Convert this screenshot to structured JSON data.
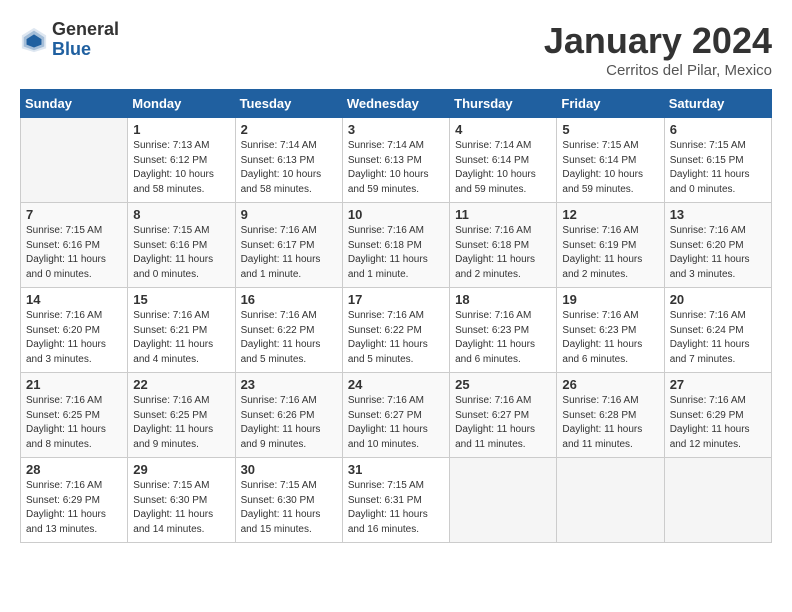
{
  "header": {
    "logo": {
      "general": "General",
      "blue": "Blue"
    },
    "title": "January 2024",
    "subtitle": "Cerritos del Pilar, Mexico"
  },
  "weekdays": [
    "Sunday",
    "Monday",
    "Tuesday",
    "Wednesday",
    "Thursday",
    "Friday",
    "Saturday"
  ],
  "weeks": [
    [
      {
        "day": "",
        "info": ""
      },
      {
        "day": "1",
        "info": "Sunrise: 7:13 AM\nSunset: 6:12 PM\nDaylight: 10 hours\nand 58 minutes."
      },
      {
        "day": "2",
        "info": "Sunrise: 7:14 AM\nSunset: 6:13 PM\nDaylight: 10 hours\nand 58 minutes."
      },
      {
        "day": "3",
        "info": "Sunrise: 7:14 AM\nSunset: 6:13 PM\nDaylight: 10 hours\nand 59 minutes."
      },
      {
        "day": "4",
        "info": "Sunrise: 7:14 AM\nSunset: 6:14 PM\nDaylight: 10 hours\nand 59 minutes."
      },
      {
        "day": "5",
        "info": "Sunrise: 7:15 AM\nSunset: 6:14 PM\nDaylight: 10 hours\nand 59 minutes."
      },
      {
        "day": "6",
        "info": "Sunrise: 7:15 AM\nSunset: 6:15 PM\nDaylight: 11 hours\nand 0 minutes."
      }
    ],
    [
      {
        "day": "7",
        "info": "Sunrise: 7:15 AM\nSunset: 6:16 PM\nDaylight: 11 hours\nand 0 minutes."
      },
      {
        "day": "8",
        "info": "Sunrise: 7:15 AM\nSunset: 6:16 PM\nDaylight: 11 hours\nand 0 minutes."
      },
      {
        "day": "9",
        "info": "Sunrise: 7:16 AM\nSunset: 6:17 PM\nDaylight: 11 hours\nand 1 minute."
      },
      {
        "day": "10",
        "info": "Sunrise: 7:16 AM\nSunset: 6:18 PM\nDaylight: 11 hours\nand 1 minute."
      },
      {
        "day": "11",
        "info": "Sunrise: 7:16 AM\nSunset: 6:18 PM\nDaylight: 11 hours\nand 2 minutes."
      },
      {
        "day": "12",
        "info": "Sunrise: 7:16 AM\nSunset: 6:19 PM\nDaylight: 11 hours\nand 2 minutes."
      },
      {
        "day": "13",
        "info": "Sunrise: 7:16 AM\nSunset: 6:20 PM\nDaylight: 11 hours\nand 3 minutes."
      }
    ],
    [
      {
        "day": "14",
        "info": "Sunrise: 7:16 AM\nSunset: 6:20 PM\nDaylight: 11 hours\nand 3 minutes."
      },
      {
        "day": "15",
        "info": "Sunrise: 7:16 AM\nSunset: 6:21 PM\nDaylight: 11 hours\nand 4 minutes."
      },
      {
        "day": "16",
        "info": "Sunrise: 7:16 AM\nSunset: 6:22 PM\nDaylight: 11 hours\nand 5 minutes."
      },
      {
        "day": "17",
        "info": "Sunrise: 7:16 AM\nSunset: 6:22 PM\nDaylight: 11 hours\nand 5 minutes."
      },
      {
        "day": "18",
        "info": "Sunrise: 7:16 AM\nSunset: 6:23 PM\nDaylight: 11 hours\nand 6 minutes."
      },
      {
        "day": "19",
        "info": "Sunrise: 7:16 AM\nSunset: 6:23 PM\nDaylight: 11 hours\nand 6 minutes."
      },
      {
        "day": "20",
        "info": "Sunrise: 7:16 AM\nSunset: 6:24 PM\nDaylight: 11 hours\nand 7 minutes."
      }
    ],
    [
      {
        "day": "21",
        "info": "Sunrise: 7:16 AM\nSunset: 6:25 PM\nDaylight: 11 hours\nand 8 minutes."
      },
      {
        "day": "22",
        "info": "Sunrise: 7:16 AM\nSunset: 6:25 PM\nDaylight: 11 hours\nand 9 minutes."
      },
      {
        "day": "23",
        "info": "Sunrise: 7:16 AM\nSunset: 6:26 PM\nDaylight: 11 hours\nand 9 minutes."
      },
      {
        "day": "24",
        "info": "Sunrise: 7:16 AM\nSunset: 6:27 PM\nDaylight: 11 hours\nand 10 minutes."
      },
      {
        "day": "25",
        "info": "Sunrise: 7:16 AM\nSunset: 6:27 PM\nDaylight: 11 hours\nand 11 minutes."
      },
      {
        "day": "26",
        "info": "Sunrise: 7:16 AM\nSunset: 6:28 PM\nDaylight: 11 hours\nand 11 minutes."
      },
      {
        "day": "27",
        "info": "Sunrise: 7:16 AM\nSunset: 6:29 PM\nDaylight: 11 hours\nand 12 minutes."
      }
    ],
    [
      {
        "day": "28",
        "info": "Sunrise: 7:16 AM\nSunset: 6:29 PM\nDaylight: 11 hours\nand 13 minutes."
      },
      {
        "day": "29",
        "info": "Sunrise: 7:15 AM\nSunset: 6:30 PM\nDaylight: 11 hours\nand 14 minutes."
      },
      {
        "day": "30",
        "info": "Sunrise: 7:15 AM\nSunset: 6:30 PM\nDaylight: 11 hours\nand 15 minutes."
      },
      {
        "day": "31",
        "info": "Sunrise: 7:15 AM\nSunset: 6:31 PM\nDaylight: 11 hours\nand 16 minutes."
      },
      {
        "day": "",
        "info": ""
      },
      {
        "day": "",
        "info": ""
      },
      {
        "day": "",
        "info": ""
      }
    ]
  ]
}
